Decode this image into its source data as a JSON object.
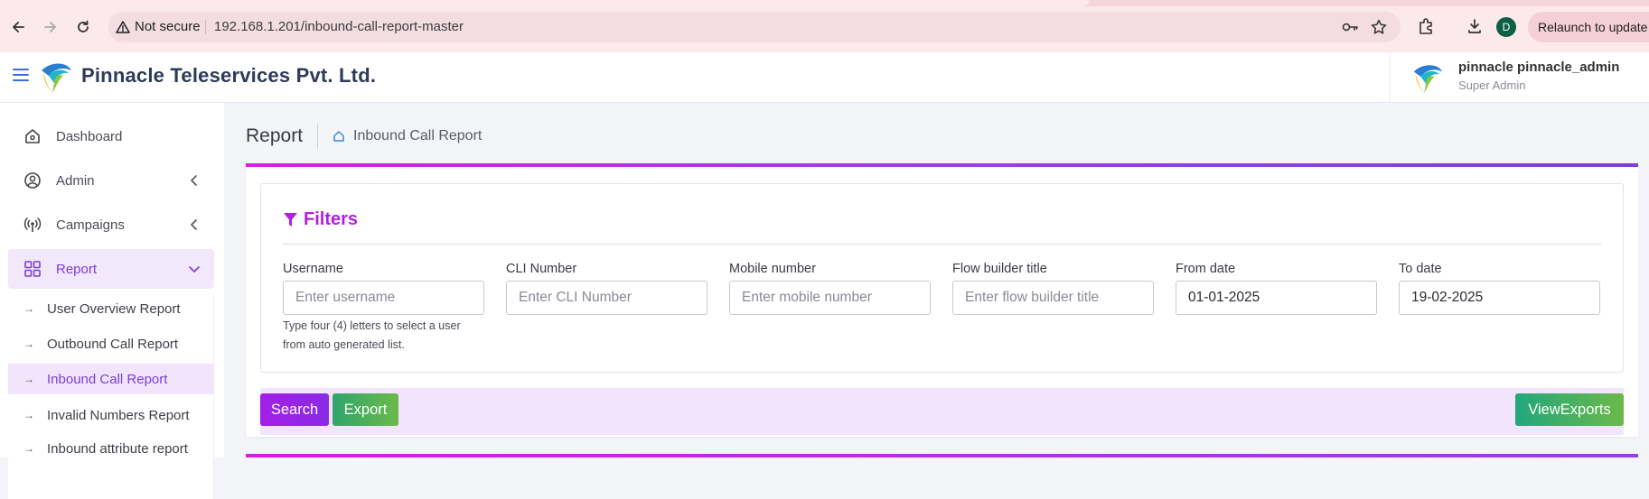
{
  "browser": {
    "security_label": "Not secure",
    "url": "192.168.1.201/inbound-call-report-master",
    "profile_initial": "D",
    "relaunch_label": "Relaunch to update"
  },
  "header": {
    "company": "Pinnacle Teleservices Pvt. Ltd.",
    "user_name": "pinnacle pinnacle_admin",
    "user_role": "Super Admin"
  },
  "sidebar": {
    "items": [
      {
        "label": "Dashboard",
        "icon": "home-icon"
      },
      {
        "label": "Admin",
        "icon": "user-circle-icon"
      },
      {
        "label": "Campaigns",
        "icon": "broadcast-icon"
      },
      {
        "label": "Report",
        "icon": "grid-icon"
      }
    ],
    "report_sub_items": [
      {
        "label": "User Overview Report"
      },
      {
        "label": "Outbound Call Report"
      },
      {
        "label": "Inbound Call Report"
      },
      {
        "label": "Invalid Numbers Report"
      },
      {
        "label": "Inbound attribute report"
      }
    ]
  },
  "breadcrumb": {
    "section": "Report",
    "page": "Inbound Call Report"
  },
  "filters": {
    "title": "Filters",
    "fields": {
      "username": {
        "label": "Username",
        "placeholder": "Enter username",
        "value": "",
        "hint": "Type four (4) letters to select a user from auto generated list."
      },
      "cli": {
        "label": "CLI Number",
        "placeholder": "Enter CLI Number",
        "value": ""
      },
      "mobile": {
        "label": "Mobile number",
        "placeholder": "Enter mobile number",
        "value": ""
      },
      "flow": {
        "label": "Flow builder title",
        "placeholder": "Enter flow builder title",
        "value": ""
      },
      "from_date": {
        "label": "From date",
        "placeholder": "",
        "value": "01-01-2025"
      },
      "to_date": {
        "label": "To date",
        "placeholder": "",
        "value": "19-02-2025"
      }
    }
  },
  "actions": {
    "search": "Search",
    "export": "Export",
    "view_exports": "ViewExports"
  },
  "colors": {
    "accent_purple": "#b21fe0",
    "sidebar_active": "#7a3fd6",
    "green": "#2fa56d"
  }
}
